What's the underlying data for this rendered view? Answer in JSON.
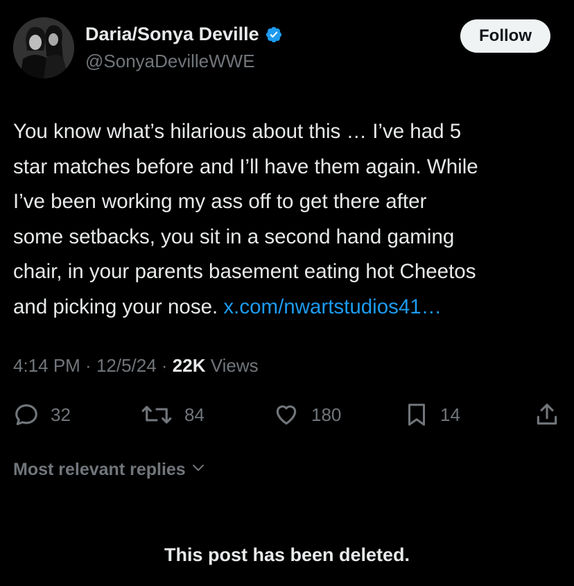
{
  "tweet": {
    "author": {
      "display_name": "Daria/Sonya Deville",
      "handle": "@SonyaDevilleWWE",
      "verified": true
    },
    "follow_label": "Follow",
    "body_lines": [
      "You know what’s hilarious about this … I’ve had 5",
      "star matches before and I’ll have them again. While",
      "I’ve been working my ass off to get there after",
      "some setbacks, you sit in a second hand gaming",
      "chair, in your parents basement eating hot Cheetos",
      "and picking your nose. "
    ],
    "link_text": "x.com/nwartstudios41…",
    "time": "4:14 PM",
    "sep1": " · ",
    "date": "12/5/24",
    "sep2": " · ",
    "views_count": "22K",
    "views_label": " Views",
    "actions": {
      "replies": "32",
      "reposts": "84",
      "likes": "180",
      "bookmarks": "14"
    }
  },
  "replies_sort_label": "Most relevant replies",
  "deleted_notice": "This post has been deleted.",
  "colors": {
    "background": "#000000",
    "primary_text": "#e7e9ea",
    "secondary_text": "#71767b",
    "link": "#1d9bf0",
    "verified_badge": "#1d9bf0",
    "follow_bg": "#eff3f4"
  }
}
